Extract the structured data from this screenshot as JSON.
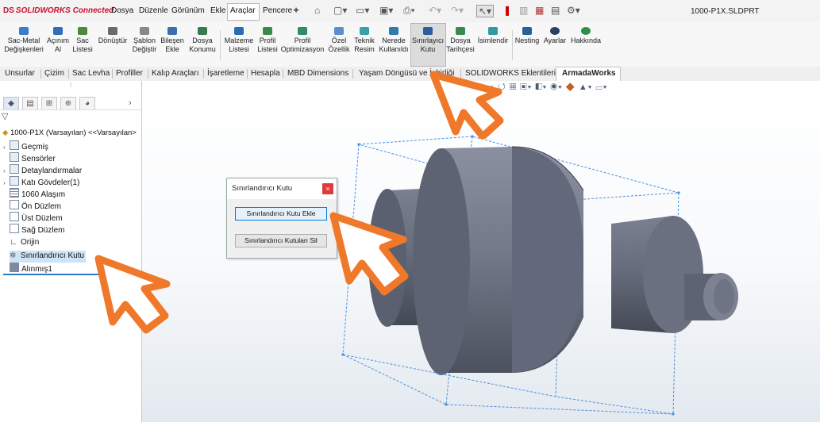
{
  "app": {
    "brand_ds": "DS",
    "brand_name": "SOLIDWORKS Connected",
    "document_title": "1000-P1X.SLDPRT"
  },
  "menu": [
    "Dosya",
    "Düzenle",
    "Görünüm",
    "Ekle",
    "Araçlar",
    "Pencere"
  ],
  "ribbon": [
    {
      "label": "Sac-Metal\nDeğişkenleri",
      "icon": "sheet-metal-icon"
    },
    {
      "label": "Açınım\nAl",
      "icon": "flatten-icon"
    },
    {
      "label": "Sac\nListesi",
      "icon": "sheet-list-icon"
    },
    {
      "label": "Dönüştür",
      "icon": "convert-icon"
    },
    {
      "label": "Şablon\nDeğiştir",
      "icon": "template-icon"
    },
    {
      "label": "Bileşen\nEkle",
      "icon": "component-icon"
    },
    {
      "label": "Dosya\nKonumu",
      "icon": "file-location-icon"
    },
    {
      "label": "Malzeme\nListesi",
      "icon": "material-list-icon"
    },
    {
      "label": "Profil\nListesi",
      "icon": "profile-list-icon"
    },
    {
      "label": "Profil\nOptimizasyon",
      "icon": "profile-opt-icon"
    },
    {
      "label": "Özel\nÖzellik",
      "icon": "custom-prop-icon"
    },
    {
      "label": "Teknik\nResim",
      "icon": "drawing-icon"
    },
    {
      "label": "Nerede\nKullanıldı",
      "icon": "where-used-icon"
    },
    {
      "label": "Sınırlayıcı\nKutu",
      "icon": "bounding-box-icon"
    },
    {
      "label": "Dosya\nTarihçesi",
      "icon": "file-history-icon"
    },
    {
      "label": "İsimlendir",
      "icon": "rename-icon"
    },
    {
      "label": "Nesting",
      "icon": "nesting-icon"
    },
    {
      "label": "Ayarlar",
      "icon": "settings-icon"
    },
    {
      "label": "Hakkında",
      "icon": "about-icon"
    }
  ],
  "tabs": [
    "Unsurlar",
    "Çizim",
    "Sac Levha",
    "Profiller",
    "Kalıp Araçları",
    "İşaretleme",
    "Hesapla",
    "MBD Dimensions",
    "Yaşam Döngüsü ve İşbirliği",
    "SOLIDWORKS Eklentileri",
    "ArmadaWorks"
  ],
  "tree": {
    "root": "1000-P1X (Varsayılan) <<Varsayılan>",
    "items": [
      {
        "label": "Geçmiş",
        "expandable": true
      },
      {
        "label": "Sensörler",
        "expandable": false
      },
      {
        "label": "Detaylandırmalar",
        "expandable": true
      },
      {
        "label": "Katı Gövdeler(1)",
        "expandable": true
      },
      {
        "label": "1060 Alaşım",
        "expandable": false
      },
      {
        "label": "Ön Düzlem",
        "expandable": false
      },
      {
        "label": "Üst Düzlem",
        "expandable": false
      },
      {
        "label": "Sağ Düzlem",
        "expandable": false
      },
      {
        "label": "Orijin",
        "expandable": false
      },
      {
        "label": "Sınırlandırıcı Kutu",
        "expandable": false,
        "selected": true
      },
      {
        "label": "Alınmış1",
        "expandable": false
      }
    ]
  },
  "dialog": {
    "title": "Sınırlandırıcı Kutu",
    "close": "×",
    "add_button": "Sınırlandırıcı Kutu Ekle",
    "remove_button": "Sınırlandırıcı Kutuları Sil"
  },
  "colors": {
    "brand": "#c8102e",
    "arrow": "#f0782a",
    "selection": "#cde4f7",
    "bbox": "#4a90e2",
    "part_body": "#5f6675"
  }
}
